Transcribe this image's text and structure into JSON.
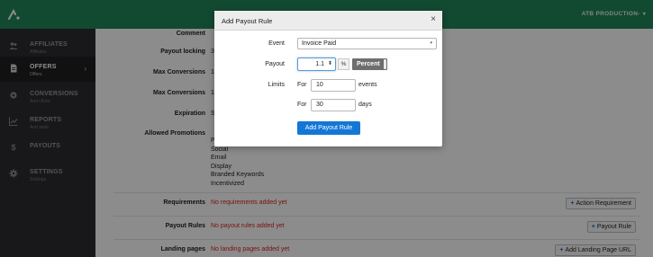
{
  "topbar": {
    "account_label": "ATB PRODUCTION-",
    "account_caret": "▾"
  },
  "sidebar": {
    "items": [
      {
        "label": "AFFILIATES",
        "sub": "Affiliates",
        "icon": "users-icon"
      },
      {
        "label": "OFFERS",
        "sub": "Offers",
        "icon": "file-icon",
        "active": true
      },
      {
        "label": "CONVERSIONS",
        "sub": "And clicks",
        "icon": "gear-icon"
      },
      {
        "label": "REPORTS",
        "sub": "And stats",
        "icon": "chart-icon"
      },
      {
        "label": "PAYOUTS",
        "sub": "",
        "icon": "dollar-icon"
      },
      {
        "label": "SETTINGS",
        "sub": "Settings",
        "icon": "cog-icon"
      }
    ],
    "active_chevron": "›"
  },
  "form": {
    "comment_label": "Comment",
    "payout_locking_label": "Payout locking",
    "payout_locking_value": "3",
    "max_conversions_label_1": "Max Conversions",
    "max_conversions_value_1": "1",
    "max_conversions_label_2": "Max Conversions",
    "max_conversions_value_2": "1",
    "expiration_label": "Expiration",
    "expiration_value": "S",
    "allowed_promotions_label": "Allowed Promotions",
    "allowed_promotions": [
      "P",
      "Social",
      "Email",
      "Display",
      "Branded Keywords",
      "Incentivized"
    ],
    "requirements_label": "Requirements",
    "requirements_value": "No requirements added yet",
    "requirements_button": "Action Requirement",
    "payout_rules_label": "Payout Rules",
    "payout_rules_value": "No payout rules added yet",
    "payout_rules_button": "Payout Rule",
    "landing_pages_label": "Landing pages",
    "landing_pages_value": "No landing pages added yet",
    "landing_pages_button": "Add Landing Page URL",
    "plus": "+"
  },
  "modal": {
    "title": "Add Payout Rule",
    "close": "×",
    "event_label": "Event",
    "event_value": "Invoice Paid",
    "event_arrow": "▾",
    "payout_label": "Payout",
    "payout_value": "1.1",
    "payout_spin": "⬍",
    "percent_symbol": "%",
    "percent_button": "Percent",
    "limits_label": "Limits",
    "for_label_1": "For",
    "limit_events_value": "10",
    "limit_events_unit": "events",
    "for_label_2": "For",
    "limit_days_value": "30",
    "limit_days_unit": "days",
    "submit_button": "Add Payout Rule"
  },
  "colors": {
    "topbar": "#21855a",
    "sidebar": "#2c2c30",
    "primary": "#1477d6",
    "error_text": "#d9261c"
  }
}
